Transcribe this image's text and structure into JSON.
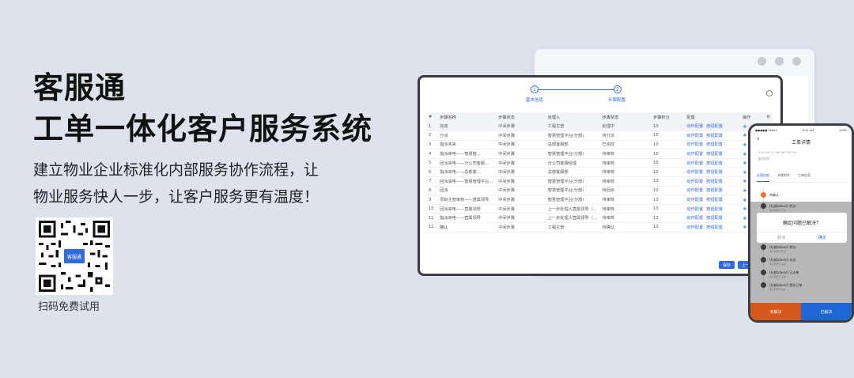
{
  "hero": {
    "title_line1": "客服通",
    "title_line2": "工单一体化客户服务系统",
    "subtitle_line1": "建立物业企业标准化内部服务协作流程，让",
    "subtitle_line2": "物业服务快人一步，让客户服务更有温度！"
  },
  "qr": {
    "caption": "扫码免费试用",
    "badge": "客服通"
  },
  "app_window": {
    "steps": [
      {
        "num": "1",
        "label": "基本信息"
      },
      {
        "num": "2",
        "label": "步骤配置"
      }
    ],
    "columns": [
      "#",
      "步骤名称",
      "步骤状态",
      "处理人",
      "步骤状态",
      "步骤积分",
      "配置",
      "操作"
    ],
    "rows": [
      [
        "1",
        "完成",
        "中间步骤",
        "工程主管",
        "处理中",
        "10"
      ],
      [
        "2",
        "分派",
        "中间步骤",
        "智慧管理平台(分部)",
        "待分派",
        "10"
      ],
      [
        "3",
        "指派未来",
        "中间步骤",
        "总部客服部",
        "已完成",
        "10"
      ],
      [
        "4",
        "指派来电——智慧管…",
        "中间步骤",
        "智慧管理平台(分部)",
        "待审核",
        "10"
      ],
      [
        "5",
        "回派来电——分公司客服…",
        "中间步骤",
        "分公司客服经理",
        "待审核",
        "10"
      ],
      [
        "6",
        "指派来电——总部客…",
        "中间步骤",
        "总部客服部",
        "待审核",
        "10"
      ],
      [
        "7",
        "回派来电——智慧管理平台…",
        "中间步骤",
        "智慧管理平台(分部)",
        "待审核",
        "10"
      ],
      [
        "8",
        "回派",
        "中间步骤",
        "智慧管理平台(分部)",
        "待回派",
        "10"
      ],
      [
        "9",
        "项目主管审核——直属领导",
        "中间步骤",
        "智慧管理平台(分部)",
        "待审核",
        "10"
      ],
      [
        "10",
        "回派来电——直属领导",
        "中间步骤",
        "上一步处理人直属领导（…",
        "待审核",
        "10"
      ],
      [
        "11",
        "指派来电——直属领导",
        "中间步骤",
        "上一步处理人直属领导（…",
        "待审核",
        "10"
      ],
      [
        "12",
        "确认",
        "中间步骤",
        "工程主管",
        "待确认",
        "10"
      ]
    ],
    "config_links": [
      "动作配置",
      "按钮配置"
    ],
    "op_symbol": "+",
    "footer_buttons": [
      "保存",
      "上一步"
    ]
  },
  "phone": {
    "status_left": "●●●●● Sketch",
    "status_center": "9:41 AM",
    "status_right": "100%",
    "title": "工单详情",
    "info_line1": "2019-06-21  ABC987701704",
    "info_line2": "服务类型",
    "tabs": [
      "处理进度",
      "关联附件",
      "工单信息"
    ],
    "timeline": [
      {
        "text": "待确认",
        "note": ""
      },
      {
        "text": "[杜威(dave)] 转派",
        "note": "客户报修已分派"
      },
      {
        "text": "[杜威(dave)] 转派",
        "note": "客户报修已转派"
      },
      {
        "text": "[杜威(dave)] 派送",
        "note": "客户报修已派送"
      },
      {
        "text": "[杜威(dave)] 已派单",
        "note": "客户报修已派单"
      },
      {
        "text": "[杜威(dave)] 提交订单",
        "note": "客户报修已提交"
      }
    ],
    "dialog": {
      "title": "确定问题已解决？",
      "cancel": "取消",
      "ok": "确定"
    },
    "buttons": {
      "left": "未解决",
      "right": "已解决"
    }
  }
}
